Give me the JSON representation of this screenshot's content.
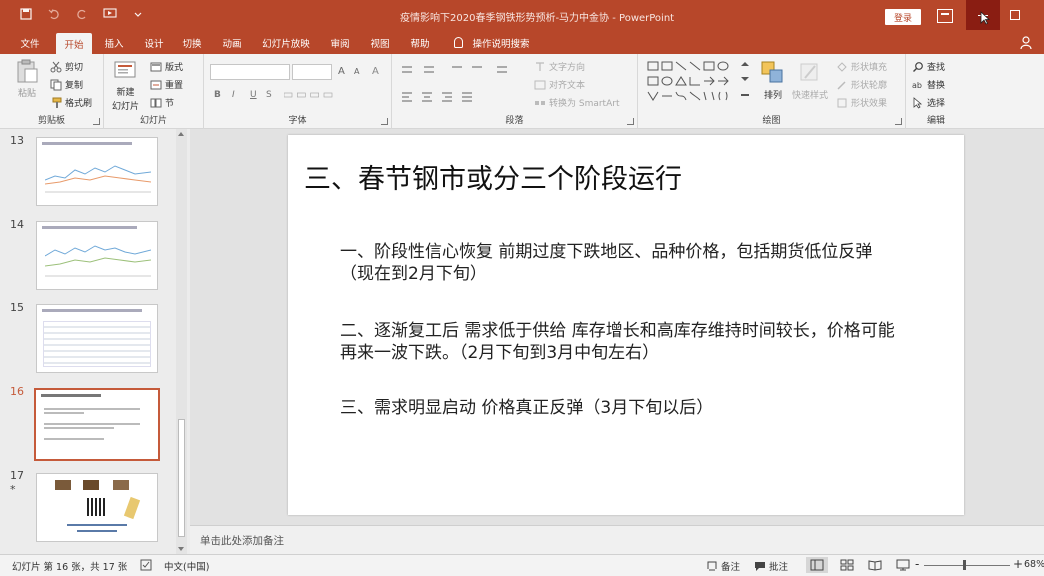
{
  "app": {
    "title": "疫情影响下2020春季钢铁形势预析-马力中金协 - PowerPoint",
    "login_label": "登录"
  },
  "tabs": [
    "文件",
    "开始",
    "插入",
    "设计",
    "切换",
    "动画",
    "幻灯片放映",
    "审阅",
    "视图",
    "帮助",
    "操作说明搜索"
  ],
  "active_tab": "开始",
  "ribbon": {
    "clipboard": {
      "label": "剪贴板",
      "paste": "粘贴",
      "cut": "剪切",
      "copy": "复制",
      "format_painter": "格式刷"
    },
    "slides": {
      "label": "幻灯片",
      "new_slide": "新建",
      "new_slide2": "幻灯片",
      "layout": "版式",
      "reset": "重置",
      "section": "节"
    },
    "font": {
      "label": "字体",
      "bold": "B",
      "italic": "I",
      "underline": "U",
      "strike": "S",
      "grow": "A",
      "shrink": "A",
      "clear": "A"
    },
    "paragraph": {
      "label": "段落",
      "text_direction": "文字方向",
      "align_text": "对齐文本",
      "smartart": "转换为 SmartArt"
    },
    "drawing": {
      "label": "绘图",
      "arrange": "排列",
      "quick_styles": "快速样式",
      "fill": "形状填充",
      "outline": "形状轮廓",
      "effects": "形状效果"
    },
    "editing": {
      "label": "编辑",
      "find": "查找",
      "replace": "替换",
      "select": "选择"
    }
  },
  "thumbnails": [
    {
      "num": "13",
      "star": ""
    },
    {
      "num": "14",
      "star": ""
    },
    {
      "num": "15",
      "star": ""
    },
    {
      "num": "16",
      "star": "",
      "selected": true
    },
    {
      "num": "17",
      "star": "*"
    }
  ],
  "slide": {
    "title": "三、春节钢市或分三个阶段运行",
    "paragraphs": [
      "一、阶段性信心恢复  前期过度下跌地区、品种价格，包括期货低位反弹（现在到2月下旬）",
      "二、逐渐复工后    需求低于供给   库存增长和高库存维持时间较长，价格可能再来一波下跌。（2月下旬到3月中旬左右）",
      "三、需求明显启动   价格真正反弹（3月下旬以后）"
    ]
  },
  "notes": {
    "placeholder": "单击此处添加备注"
  },
  "status": {
    "slide_info": "幻灯片 第 16 张，共 17 张",
    "language": "中文(中国)",
    "notes_btn": "备注",
    "comments_btn": "批注",
    "zoom_minus": "-",
    "zoom_plus": "+",
    "zoom_level": "68%"
  }
}
